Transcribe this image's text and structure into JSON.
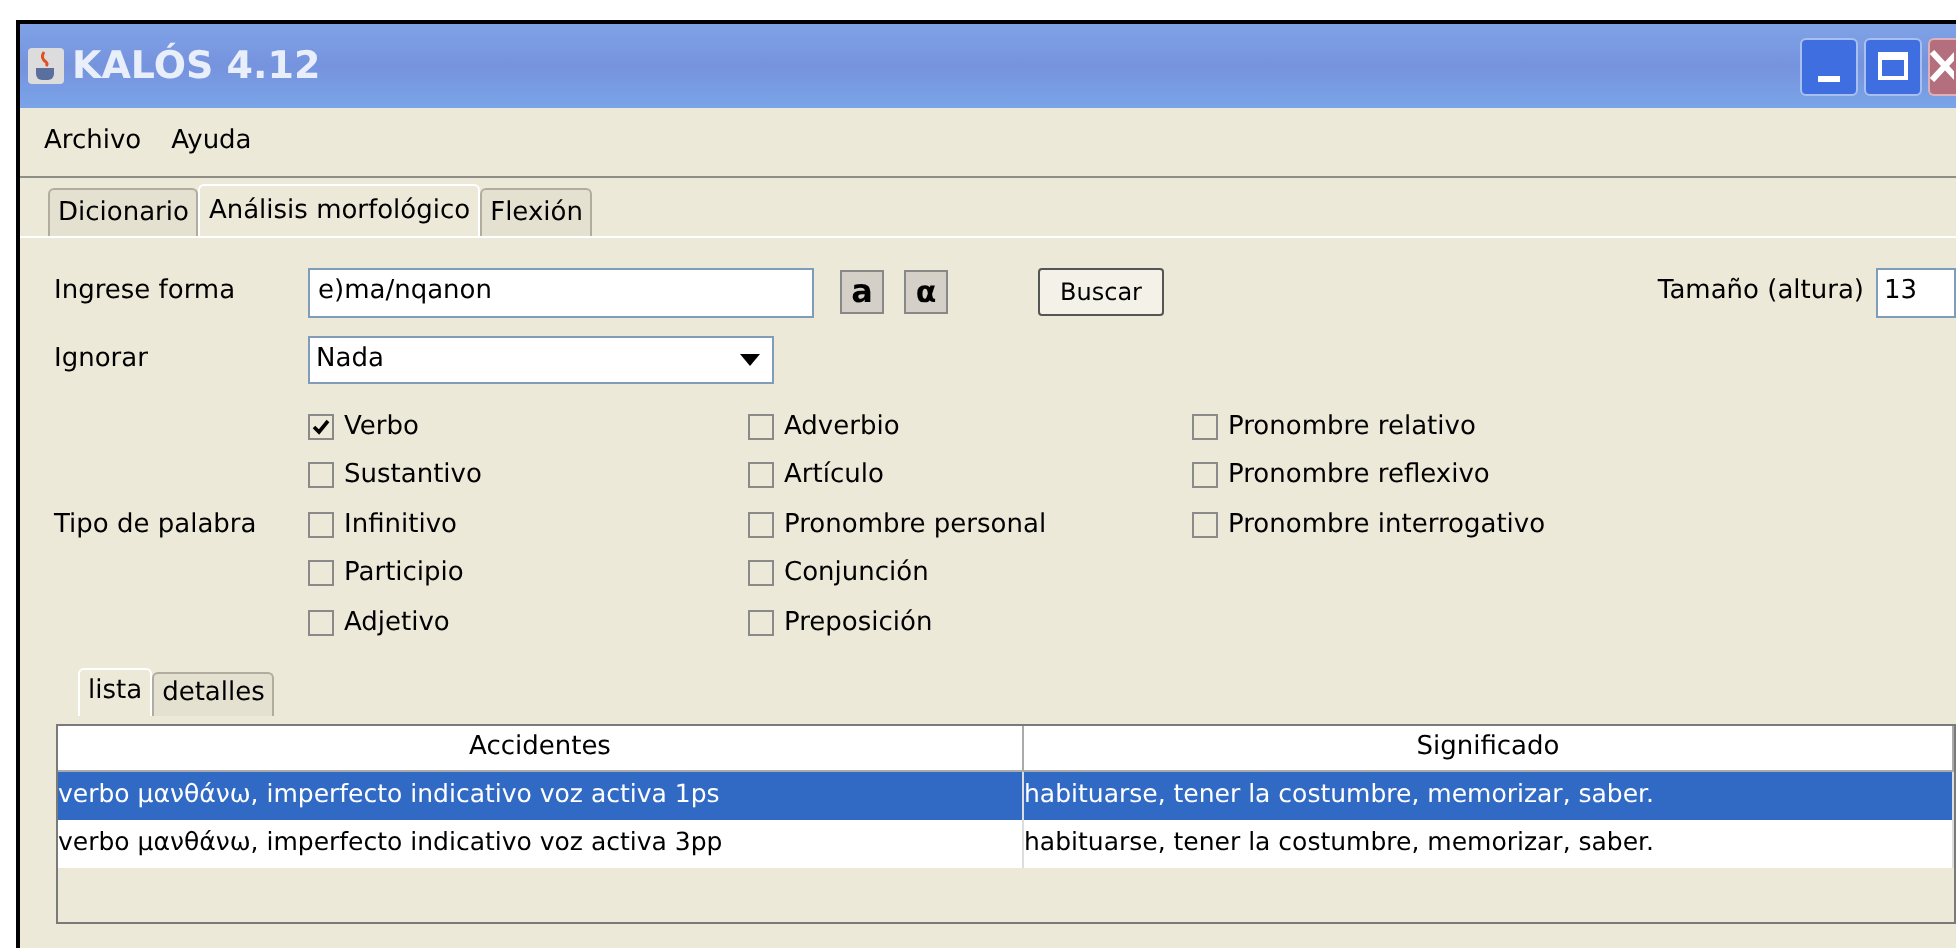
{
  "window": {
    "title": "KALÓS 4.12"
  },
  "menu": [
    "Archivo",
    "Ayuda"
  ],
  "tabs": [
    {
      "label": "Dicionario",
      "selected": false
    },
    {
      "label": "Análisis morfológico",
      "selected": true
    },
    {
      "label": "Flexión",
      "selected": false
    }
  ],
  "form": {
    "input_label": "Ingrese forma",
    "input_value": "e)ma/nqanon",
    "latin_button": "a",
    "greek_button": "α",
    "search_button": "Buscar",
    "size_label": "Tamaño (altura)",
    "size_value": "13",
    "ignore_label": "Ignorar",
    "ignore_value": "Nada",
    "word_type_label": "Tipo de palabra"
  },
  "word_types": [
    {
      "label": "Verbo",
      "checked": true
    },
    {
      "label": "Sustantivo",
      "checked": false
    },
    {
      "label": "Infinitivo",
      "checked": false
    },
    {
      "label": "Participio",
      "checked": false
    },
    {
      "label": "Adjetivo",
      "checked": false
    },
    {
      "label": "Adverbio",
      "checked": false
    },
    {
      "label": "Artículo",
      "checked": false
    },
    {
      "label": "Pronombre personal",
      "checked": false
    },
    {
      "label": "Conjunción",
      "checked": false
    },
    {
      "label": "Preposición",
      "checked": false
    },
    {
      "label": "Pronombre relativo",
      "checked": false
    },
    {
      "label": "Pronombre reflexivo",
      "checked": false
    },
    {
      "label": "Pronombre interrogativo",
      "checked": false
    }
  ],
  "result_tabs": [
    {
      "label": "lista",
      "selected": true
    },
    {
      "label": "detalles",
      "selected": false
    }
  ],
  "table": {
    "columns": [
      "Accidentes",
      "Significado"
    ],
    "rows": [
      {
        "cells": [
          "verbo μανθάνω, imperfecto indicativo voz activa 1ps",
          "habituarse, tener la costumbre, memorizar, saber."
        ],
        "selected": true
      },
      {
        "cells": [
          "verbo μανθάνω, imperfecto indicativo voz activa 3pp",
          "habituarse, tener la costumbre, memorizar, saber."
        ],
        "selected": false
      }
    ]
  }
}
